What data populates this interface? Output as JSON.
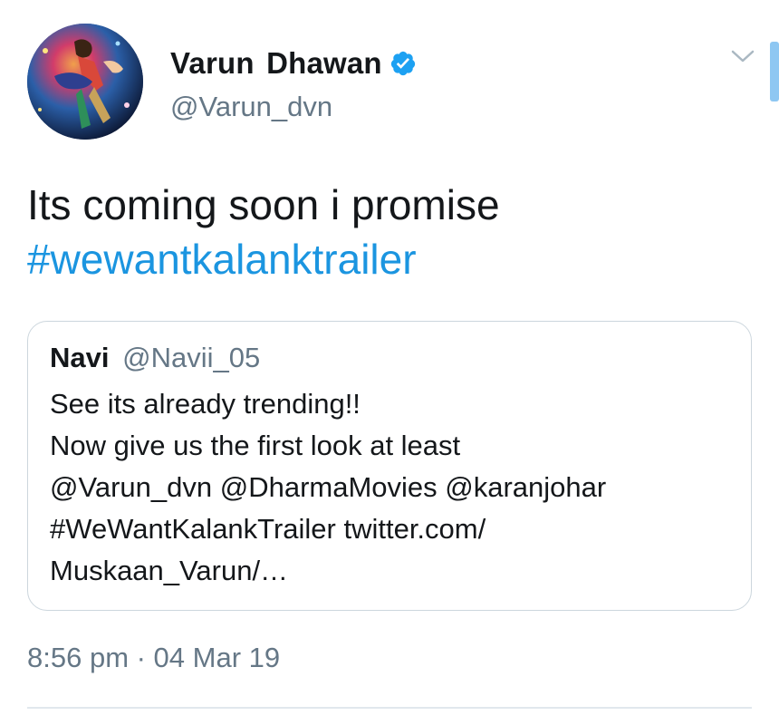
{
  "author": {
    "name": "Varun  Dhawan",
    "handle": "@Varun_dvn",
    "verified": true,
    "avatar_icon": "profile-photo"
  },
  "tweet": {
    "text_line_1": "Its coming soon i promise",
    "hashtag": "#wewantkalanktrailer"
  },
  "quoted_tweet": {
    "name": "Navi",
    "handle": "@Navii_05",
    "lines": [
      "See its already trending!!",
      "Now give us the first look at least",
      "@Varun_dvn @DharmaMovies @karanjohar",
      "#WeWantKalankTrailer twitter.com/",
      "Muskaan_Varun/…"
    ]
  },
  "timestamp": "8:56 pm · 04 Mar 19",
  "colors": {
    "link": "#1b95e0",
    "secondary_text": "#657786",
    "border": "#ccd6dd",
    "verified_badge": "#1da1f2"
  },
  "icons": {
    "verified": "verified-badge-icon",
    "menu": "chevron-down-icon"
  }
}
